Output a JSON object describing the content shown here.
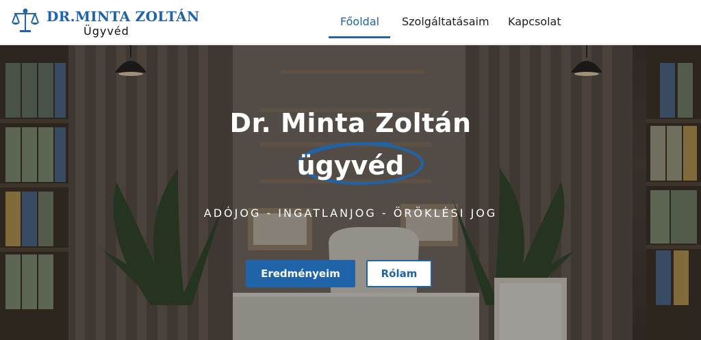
{
  "header": {
    "logo": {
      "name": "DR.MINTA ZOLTÁN",
      "subtitle": "Ügyvéd",
      "icon": "scales-of-justice-icon"
    },
    "nav": {
      "items": [
        {
          "label": "Főoldal",
          "active": true
        },
        {
          "label": "Szolgáltatásaim",
          "active": false
        },
        {
          "label": "Kapcsolat",
          "active": false
        }
      ]
    }
  },
  "hero": {
    "title": "Dr. Minta Zoltán",
    "subtitle": "ügyvéd",
    "practice_areas": "ADÓJOG - INGATLANJOG - ÖRÖKLÉSI JOG",
    "buttons": {
      "primary": "Eredményeim",
      "secondary": "Rólam"
    }
  },
  "colors": {
    "brand_blue": "#1f63a8",
    "text_dark": "#1d1d1d",
    "white": "#ffffff"
  }
}
